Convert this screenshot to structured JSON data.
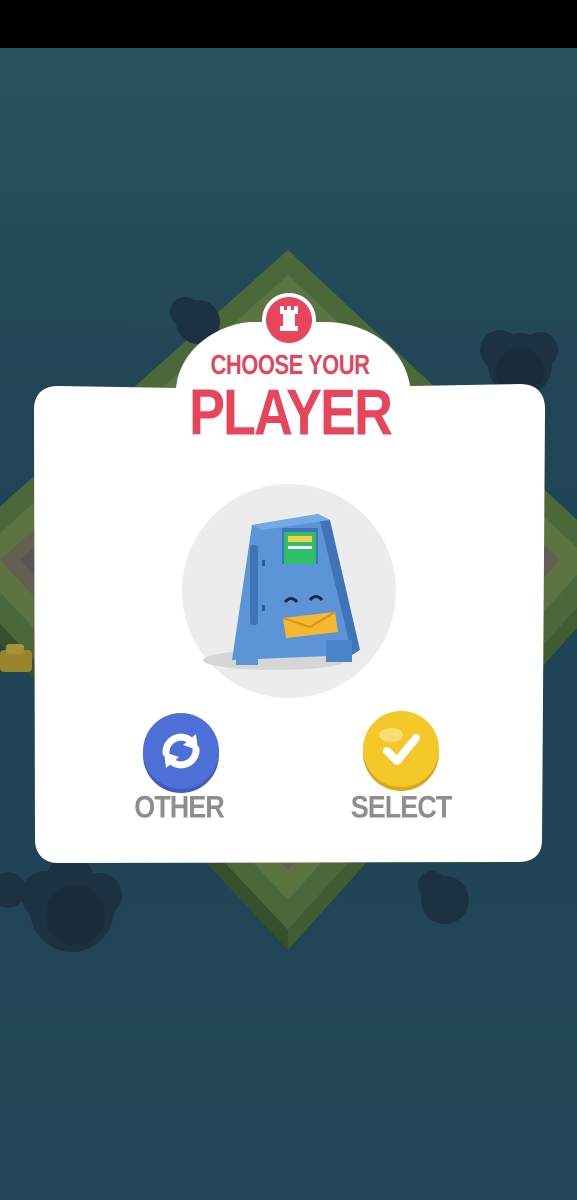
{
  "dialog": {
    "title_small": "CHOOSE YOUR",
    "title_big": "PLAYER",
    "header_icon": "rook-icon",
    "character": "mailbox-character",
    "other_button": {
      "label": "OTHER",
      "icon": "refresh-icon"
    },
    "select_button": {
      "label": "SELECT",
      "icon": "check-icon"
    }
  },
  "colors": {
    "accent_red": "#e8455c",
    "other_blue": "#4f6fd8",
    "select_yellow": "#f5c82a",
    "label_gray": "#8e8e8e"
  }
}
